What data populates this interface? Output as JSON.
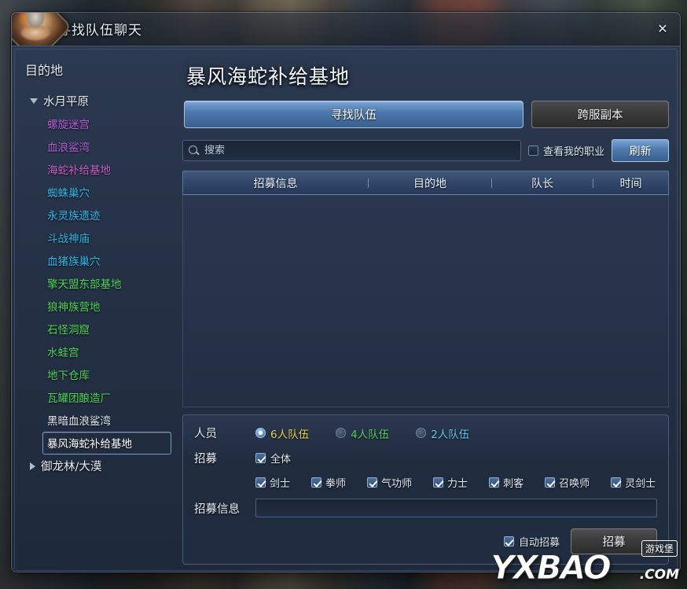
{
  "window": {
    "title": "寻找队伍聊天",
    "close_label": "✕",
    "avatar_name": "character-portrait"
  },
  "sidebar": {
    "title": "目的地",
    "groups": [
      {
        "label": "水月平原",
        "expanded": true,
        "items": [
          {
            "label": "螺旋迷宫",
            "color": "#b45cd8"
          },
          {
            "label": "血浪鲨湾",
            "color": "#b45cd8"
          },
          {
            "label": "海蛇补给基地",
            "color": "#c95fc9"
          },
          {
            "label": "蜘蛛巢穴",
            "color": "#2fb8e8"
          },
          {
            "label": "永灵族遗迹",
            "color": "#2fb8e8"
          },
          {
            "label": "斗战神庙",
            "color": "#2fb8e8"
          },
          {
            "label": "血猪族巢穴",
            "color": "#2fb8e8"
          },
          {
            "label": "擎天盟东部基地",
            "color": "#4fd35a"
          },
          {
            "label": "狼神族营地",
            "color": "#4fd35a"
          },
          {
            "label": "石怪洞窟",
            "color": "#4fd35a"
          },
          {
            "label": "水蛙宫",
            "color": "#4fd35a"
          },
          {
            "label": "地下仓库",
            "color": "#4fd35a"
          },
          {
            "label": "瓦罐团酿造厂",
            "color": "#4fd35a"
          },
          {
            "label": "黑暗血浪鲨湾",
            "color": "#e6ecf3"
          },
          {
            "label": "暴风海蛇补给基地",
            "color": "#ffffff",
            "selected": true
          }
        ]
      },
      {
        "label": "御龙林/大漠",
        "expanded": false,
        "items": []
      }
    ]
  },
  "main": {
    "dungeon_title": "暴风海蛇补给基地",
    "tabs": [
      {
        "label": "寻找队伍",
        "active": true
      },
      {
        "label": "跨服副本",
        "active": false
      }
    ],
    "search": {
      "placeholder": "搜索",
      "value": ""
    },
    "my_class_filter": {
      "label": "查看我的职业",
      "checked": false
    },
    "refresh_label": "刷新",
    "table": {
      "columns": [
        "招募信息",
        "目的地",
        "队长",
        "时间"
      ],
      "rows": []
    }
  },
  "form": {
    "party_size": {
      "label": "人员",
      "options": [
        {
          "label": "6人队伍",
          "color": "#e8d24a",
          "selected": true
        },
        {
          "label": "4人队伍",
          "color": "#4fd35a",
          "selected": false
        },
        {
          "label": "2人队伍",
          "color": "#5ec8e8",
          "selected": false
        }
      ]
    },
    "recruit": {
      "label": "招募",
      "all": {
        "label": "全体",
        "checked": true
      },
      "classes": [
        {
          "label": "剑士",
          "checked": true
        },
        {
          "label": "拳师",
          "checked": true
        },
        {
          "label": "气功师",
          "checked": true
        },
        {
          "label": "力士",
          "checked": true
        },
        {
          "label": "刺客",
          "checked": true
        },
        {
          "label": "召唤师",
          "checked": true
        },
        {
          "label": "灵剑士",
          "checked": true
        }
      ]
    },
    "message": {
      "label": "招募信息",
      "value": "",
      "placeholder": ""
    },
    "auto_recruit": {
      "label": "自动招募",
      "checked": true
    },
    "submit_label": "招募"
  },
  "watermark": {
    "text": "YXBAO",
    "domain": ".COM",
    "badge": "游戏堡"
  }
}
